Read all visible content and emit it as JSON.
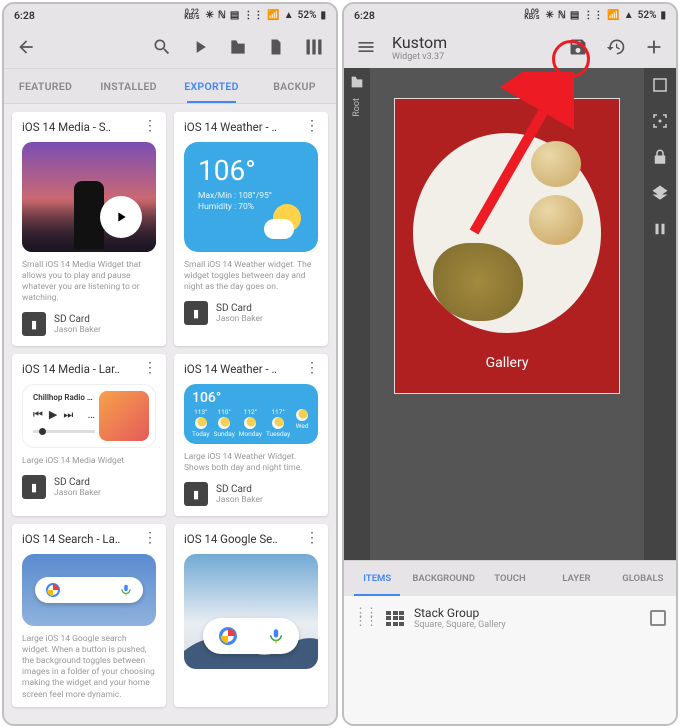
{
  "status": {
    "time": "6:28",
    "kb1": "0.22",
    "kb1b": "KB/s",
    "kb2": "0.09",
    "kb2b": "KB/s",
    "batt": "52%"
  },
  "left": {
    "tabs": [
      "FEATURED",
      "INSTALLED",
      "EXPORTED",
      "BACKUP"
    ],
    "cards": {
      "c0": {
        "title": "iOS 14 Media - S‥",
        "desc": "Small iOS 14 Media Widget that allows you to play and pause whatever you are listening to or watching.",
        "footTitle": "SD Card",
        "footSub": "Jason Baker"
      },
      "c1": {
        "title": "iOS 14 Weather - ‥",
        "temp": "106°",
        "sub1": "Max/Min : 108°/95°",
        "sub2": "Humidity : 70%",
        "desc": "Small iOS 14 Weather widget. The widget toggles between day and night as the day goes on.",
        "footTitle": "SD Card",
        "footSub": "Jason Baker"
      },
      "c2": {
        "title": "iOS 14 Media - Lar‥",
        "radio": "Chillhop Radio …",
        "desc": "Large iOS 14 Media Widget",
        "footTitle": "SD Card",
        "footSub": "Jason Baker"
      },
      "c3": {
        "title": "iOS 14 Weather - ‥",
        "temp": "106°",
        "desc": "Large iOS 14 Weather Widget. Shows both day and night time.",
        "footTitle": "SD Card",
        "footSub": "Jason Baker",
        "days": [
          "Today",
          "Sunday",
          "Monday",
          "Tuesday",
          "Wed"
        ],
        "his": [
          "113°",
          "110°",
          "112°",
          "117°",
          ""
        ],
        "los": [
          "",
          "",
          "",
          "",
          ""
        ]
      },
      "c4": {
        "title": "iOS 14 Search - La‥",
        "desc": "Large iOS 14 Google search widget. When a button is pushed, the background toggles between images in a folder of your choosing making the widget and your home screen feel more dynamic."
      },
      "c5": {
        "title": "iOS 14 Google Se‥"
      }
    }
  },
  "right": {
    "title": "Kustom",
    "sub": "Widget v3.37",
    "rootLabel": "Root",
    "galleryLabel": "Gallery",
    "tabs": [
      "ITEMS",
      "BACKGROUND",
      "TOUCH",
      "LAYER",
      "GLOBALS"
    ],
    "item": {
      "title": "Stack Group",
      "sub": "Square, Square, Gallery"
    }
  }
}
